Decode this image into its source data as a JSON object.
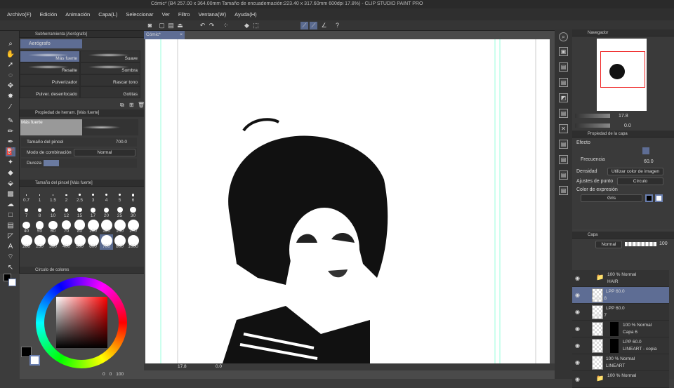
{
  "title": "Cómic* (B4 257.00 x 364.00mm Tamaño de encuadernación:223.40 x 317.60mm 600dpi 17.8%)  - CLIP STUDIO PAINT PRO",
  "menu": [
    "Archivo(F)",
    "Edición",
    "Animación",
    "Capa(L)",
    "Seleccionar",
    "Ver",
    "Filtro",
    "Ventana(W)",
    "Ayuda(H)"
  ],
  "subtool": {
    "header": "Subherramienta [Aerógrafo]",
    "group": "Aerógrafo",
    "brushes": [
      "Más fuerte",
      "Suave",
      "Resalte",
      "Sombra",
      "Pulverizador",
      "Rascar tono",
      "Pulver. desenfocado",
      "Gotitas"
    ]
  },
  "toolprop": {
    "header": "Propiedad de herram. [Más fuerte]",
    "preview": "Más fuerte",
    "size_label": "Tamaño del pincel",
    "size_value": "700.0",
    "blend_label": "Modo de combinación",
    "blend_value": "Normal",
    "hardness_label": "Dureza",
    "hardness_level": 1
  },
  "brushsize": {
    "header": "Tamaño del pincel [Más fuerte]",
    "sizes": [
      "0.7",
      "1",
      "1.5",
      "2",
      "2.5",
      "3",
      "4",
      "5",
      "6",
      "7",
      "8",
      "10",
      "12",
      "15",
      "17",
      "20",
      "25",
      "30",
      "40",
      "50",
      "60",
      "70",
      "80",
      "100",
      "120",
      "150",
      "170",
      "200",
      "250",
      "300",
      "400",
      "500",
      "600",
      "700",
      "800",
      "1000"
    ],
    "selected": "700"
  },
  "colorcircle": {
    "header": "Círculo de colores",
    "h": "0",
    "s": "0",
    "v": "100"
  },
  "canvas": {
    "tab": "Cómic*",
    "zoom": "17.8",
    "angle": "0.0"
  },
  "navigator": {
    "header": "Navegador",
    "zoom": "17.8",
    "angle": "0.0"
  },
  "layerprop": {
    "header": "Propiedad de la capa",
    "effect": "Efecto",
    "freq_label": "Frecuencia",
    "freq_value": "60.0",
    "density_label": "Densidad",
    "density_value": "Utilizar color de imagen",
    "dot_label": "Ajustes de punto",
    "dot_value": "Círculo",
    "expr_label": "Color de expresión",
    "expr_value": "Gris"
  },
  "layers": {
    "header": "Capa",
    "blend": "Normal",
    "opacity": "100",
    "items": [
      {
        "line1": "100 % Normal",
        "line2": "HAIR",
        "type": "folder"
      },
      {
        "line1": "LPP 60.0",
        "line2": "Capa 8",
        "type": "tone",
        "selected": true
      },
      {
        "line1": "LPP 60.0",
        "line2": "Capa 7",
        "type": "tone"
      },
      {
        "line1": "100 % Normal",
        "line2": "Capa 6",
        "type": "mask"
      },
      {
        "line1": "LPP 60.0",
        "line2": "LINEART - copia",
        "type": "masktone"
      },
      {
        "line1": "100 % Normal",
        "line2": "LINEART",
        "type": "plain"
      },
      {
        "line1": "100 % Normal",
        "line2": "",
        "type": "folder"
      }
    ]
  },
  "colors": {
    "accent": "#5e6d94",
    "fg": "#000000",
    "bg": "#ffffff"
  }
}
